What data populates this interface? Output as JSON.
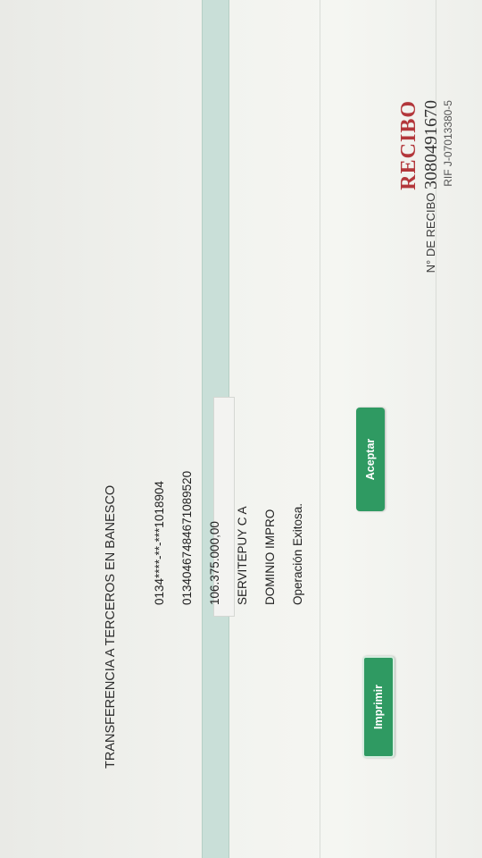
{
  "receipt": {
    "title": "RECIBO",
    "number_label": "N° DE RECIBO",
    "number": "3080491670",
    "rif": "RIF J-07013380-5"
  },
  "operation_title": "TRANSFERENCIA A TERCEROS EN BANESCO",
  "fields": {
    "source_account": "0134****-**-***1018904",
    "destination_account": "01340467484671089520",
    "amount": "106.375.000,00",
    "beneficiary": "SERVITEPUY C A",
    "concept": "DOMINIO IMPRO",
    "status": "Operación Exitosa."
  },
  "buttons": {
    "print_label": "Imprimir",
    "accept_label": "Aceptar"
  },
  "colors": {
    "brand_red": "#b3373b",
    "button_green": "#2f9a62",
    "stripe": "#c9dfd8"
  }
}
